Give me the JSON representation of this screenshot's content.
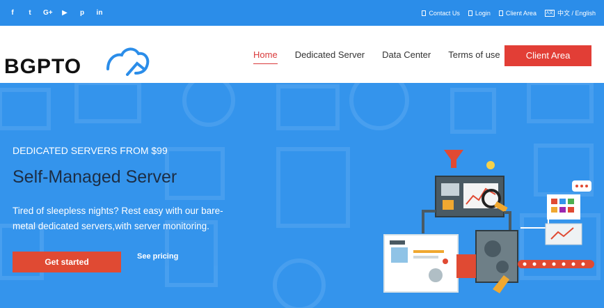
{
  "topbar": {
    "social": [
      {
        "icon": "facebook-icon",
        "glyph": "f"
      },
      {
        "icon": "twitter-icon",
        "glyph": "t"
      },
      {
        "icon": "google-plus-icon",
        "glyph": "G+"
      },
      {
        "icon": "youtube-icon",
        "glyph": "▶"
      },
      {
        "icon": "pinterest-icon",
        "glyph": "p"
      },
      {
        "icon": "linkedin-icon",
        "glyph": "in"
      }
    ],
    "contact_label": "Contact Us",
    "login_label": "Login",
    "client_area_label": "Client Area",
    "language_label": "中文 / English"
  },
  "brand": {
    "logo_text": "BGPTO"
  },
  "nav": {
    "items": [
      "Home",
      "Dedicated Server",
      "Data Center",
      "Terms of use"
    ],
    "active": "Home",
    "client_area_button": "Client Area"
  },
  "hero": {
    "eyebrow": "DEDICATED SERVERS FROM $99",
    "headline": "Self-Managed Server",
    "description": "Tired of sleepless nights? Rest easy with our bare-metal dedicated servers,with server monitoring.",
    "cta_label": "Get started",
    "pricing_link": "See pricing"
  },
  "colors": {
    "topbar": "#2b8de9",
    "hero": "#3494ec",
    "accent_red": "#e23e36",
    "headline": "#1c2d44"
  }
}
